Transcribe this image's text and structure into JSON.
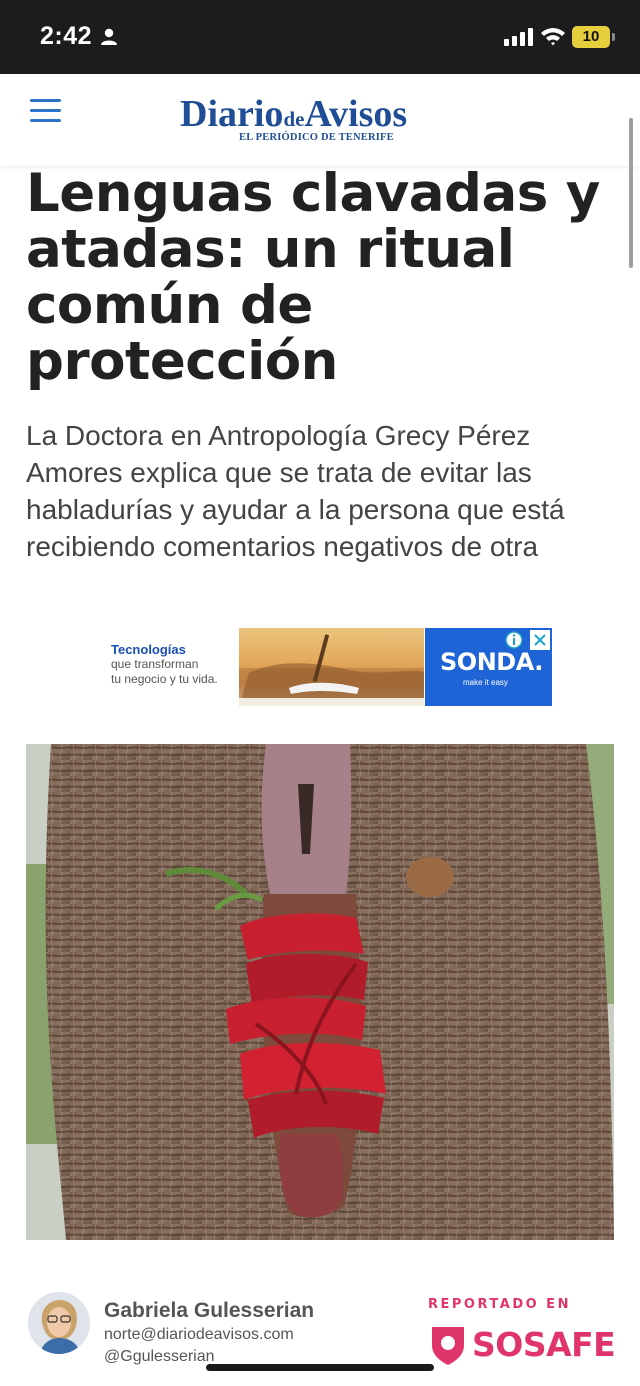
{
  "status_bar": {
    "time": "2:42",
    "battery": "10"
  },
  "header": {
    "logo_part1": "Diario",
    "logo_part2": "de",
    "logo_part3": "Avisos",
    "logo_tagline": "EL PERIÓDICO DE TENERIFE"
  },
  "article": {
    "headline": "Lenguas clavadas y atadas: un ritual común de protección",
    "subtitle": "La Doctora en Antropología Grecy Pérez Amores explica que se trata de evitar las habladurías y ayudar a la persona que está recibiendo comentarios negativos de otra"
  },
  "ad": {
    "title": "Tecnologías",
    "line1": "que transforman",
    "line2": "tu negocio y tu vida.",
    "brand": "SONDA.",
    "brand_tag": "make it easy"
  },
  "author": {
    "name": "Gabriela Gulesserian",
    "email": "norte@diariodeavisos.com",
    "handle": "@Ggulesserian"
  },
  "report": {
    "label": "REPORTADO EN",
    "brand": "SOSAFE"
  },
  "colors": {
    "brand_blue": "#1f4e96",
    "menu_blue": "#2a73c8",
    "sosafe_pink": "#e0356b",
    "ribbon_red": "#c8202e"
  }
}
